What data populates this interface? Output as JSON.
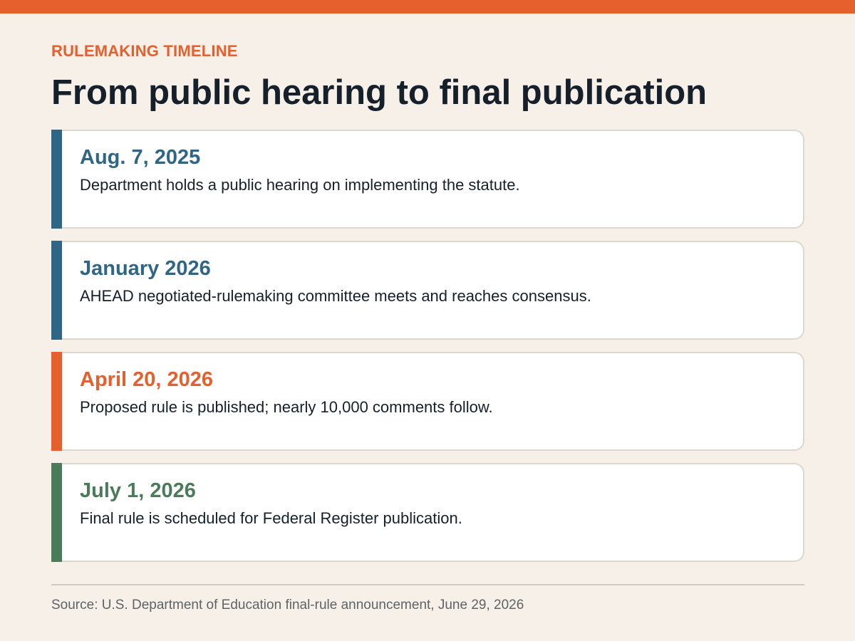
{
  "colors": {
    "accent_orange": "#e5602d",
    "accent_blue": "#2f6685",
    "accent_green": "#4a7b5a",
    "title": "#15202b",
    "background": "#f6f0e9"
  },
  "header": {
    "eyebrow": "RULEMAKING TIMELINE",
    "title": "From public hearing to final publication"
  },
  "events": [
    {
      "date": "Aug. 7, 2025",
      "description": "Department holds a public hearing on implementing the statute.",
      "color": "#2f6685"
    },
    {
      "date": "January 2026",
      "description": "AHEAD negotiated-rulemaking committee meets and reaches consensus.",
      "color": "#2f6685"
    },
    {
      "date": "April 20, 2026",
      "description": "Proposed rule is published; nearly 10,000 comments follow.",
      "color": "#e5602d"
    },
    {
      "date": "July 1, 2026",
      "description": "Final rule is scheduled for Federal Register publication.",
      "color": "#4a7b5a"
    }
  ],
  "footer": {
    "source": "Source: U.S. Department of Education final-rule announcement, June 29, 2026"
  }
}
